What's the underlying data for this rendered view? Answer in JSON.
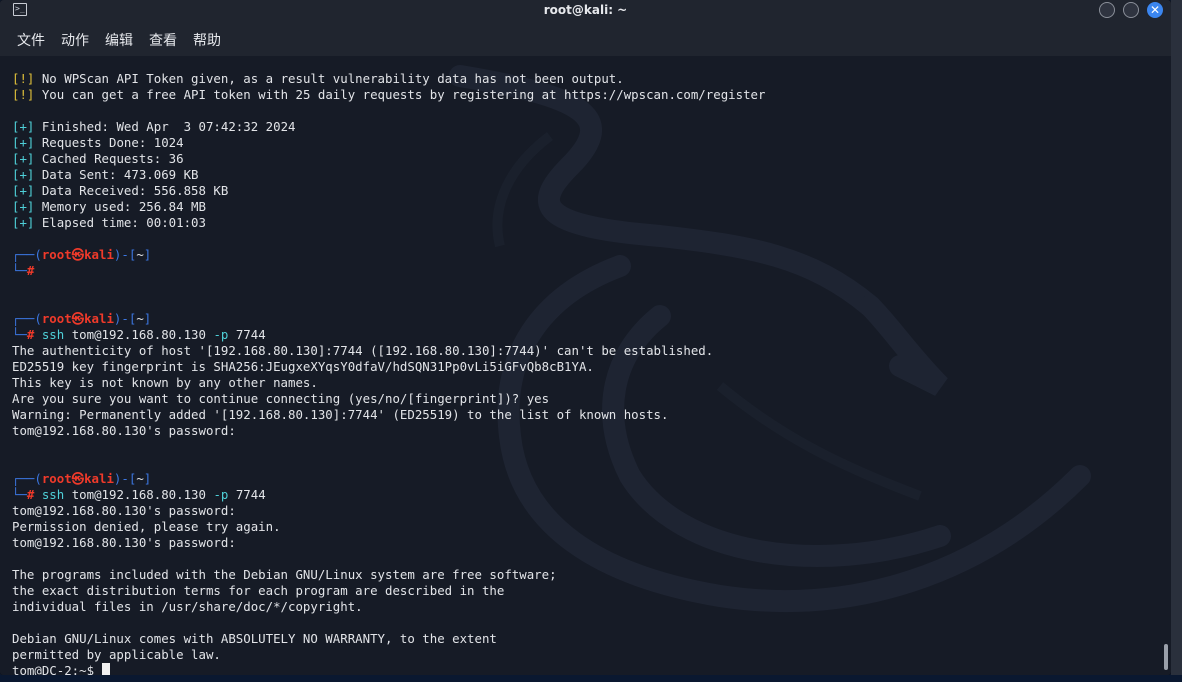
{
  "window": {
    "title": "root@kali: ~",
    "close_glyph": "✕"
  },
  "menu": [
    "文件",
    "动作",
    "编辑",
    "查看",
    "帮助"
  ],
  "terminal": {
    "lines": [
      [
        {
          "t": "[!]",
          "c": "y"
        },
        {
          "t": " No WPScan API Token given, as a result vulnerability data has not been output."
        }
      ],
      [
        {
          "t": "[!]",
          "c": "y"
        },
        {
          "t": " You can get a free API token with 25 daily requests by registering at https://wpscan.com/register"
        }
      ],
      [],
      [
        {
          "t": "[+]",
          "c": "c"
        },
        {
          "t": " Finished: Wed Apr  3 07:42:32 2024"
        }
      ],
      [
        {
          "t": "[+]",
          "c": "c"
        },
        {
          "t": " Requests Done: 1024"
        }
      ],
      [
        {
          "t": "[+]",
          "c": "c"
        },
        {
          "t": " Cached Requests: 36"
        }
      ],
      [
        {
          "t": "[+]",
          "c": "c"
        },
        {
          "t": " Data Sent: 473.069 KB"
        }
      ],
      [
        {
          "t": "[+]",
          "c": "c"
        },
        {
          "t": " Data Received: 556.858 KB"
        }
      ],
      [
        {
          "t": "[+]",
          "c": "c"
        },
        {
          "t": " Memory used: 256.84 MB"
        }
      ],
      [
        {
          "t": "[+]",
          "c": "c"
        },
        {
          "t": " Elapsed time: 00:01:03"
        }
      ],
      [],
      [
        {
          "t": "┌──(",
          "c": "b"
        },
        {
          "t": "root㉿kali",
          "c": "r"
        },
        {
          "t": ")-[",
          "c": "b"
        },
        {
          "t": "~"
        },
        {
          "t": "]",
          "c": "b"
        }
      ],
      [
        {
          "t": "└─",
          "c": "b"
        },
        {
          "t": "#",
          "c": "r"
        }
      ],
      [],
      [],
      [
        {
          "t": "┌──(",
          "c": "b"
        },
        {
          "t": "root㉿kali",
          "c": "r"
        },
        {
          "t": ")-[",
          "c": "b"
        },
        {
          "t": "~"
        },
        {
          "t": "]",
          "c": "b"
        }
      ],
      [
        {
          "t": "└─",
          "c": "b"
        },
        {
          "t": "#",
          "c": "r"
        },
        {
          "t": " ssh",
          "c": "c"
        },
        {
          "t": " tom@192.168.80.130 "
        },
        {
          "t": "-p",
          "c": "c"
        },
        {
          "t": " 7744"
        }
      ],
      [
        {
          "t": "The authenticity of host '[192.168.80.130]:7744 ([192.168.80.130]:7744)' can't be established."
        }
      ],
      [
        {
          "t": "ED25519 key fingerprint is SHA256:JEugxeXYqsY0dfaV/hdSQN31Pp0vLi5iGFvQb8cB1YA."
        }
      ],
      [
        {
          "t": "This key is not known by any other names."
        }
      ],
      [
        {
          "t": "Are you sure you want to continue connecting (yes/no/[fingerprint])? yes"
        }
      ],
      [
        {
          "t": "Warning: Permanently added '[192.168.80.130]:7744' (ED25519) to the list of known hosts."
        }
      ],
      [
        {
          "t": "tom@192.168.80.130's password:"
        }
      ],
      [],
      [],
      [
        {
          "t": "┌──(",
          "c": "b"
        },
        {
          "t": "root㉿kali",
          "c": "r"
        },
        {
          "t": ")-[",
          "c": "b"
        },
        {
          "t": "~"
        },
        {
          "t": "]",
          "c": "b"
        }
      ],
      [
        {
          "t": "└─",
          "c": "b"
        },
        {
          "t": "#",
          "c": "r"
        },
        {
          "t": " ssh",
          "c": "c"
        },
        {
          "t": " tom@192.168.80.130 "
        },
        {
          "t": "-p",
          "c": "c"
        },
        {
          "t": " 7744"
        }
      ],
      [
        {
          "t": "tom@192.168.80.130's password:"
        }
      ],
      [
        {
          "t": "Permission denied, please try again."
        }
      ],
      [
        {
          "t": "tom@192.168.80.130's password:"
        }
      ],
      [],
      [
        {
          "t": "The programs included with the Debian GNU/Linux system are free software;"
        }
      ],
      [
        {
          "t": "the exact distribution terms for each program are described in the"
        }
      ],
      [
        {
          "t": "individual files in /usr/share/doc/*/copyright."
        }
      ],
      [],
      [
        {
          "t": "Debian GNU/Linux comes with ABSOLUTELY NO WARRANTY, to the extent"
        }
      ],
      [
        {
          "t": "permitted by applicable law."
        }
      ],
      [
        {
          "t": "tom@DC-2:~$ "
        }
      ]
    ]
  },
  "colors": {
    "warn": "#e0c03a",
    "info": "#4fd0d8",
    "prompt_frame": "#3b76e0",
    "prompt_user": "#f03a2a",
    "background": "#161b26"
  }
}
